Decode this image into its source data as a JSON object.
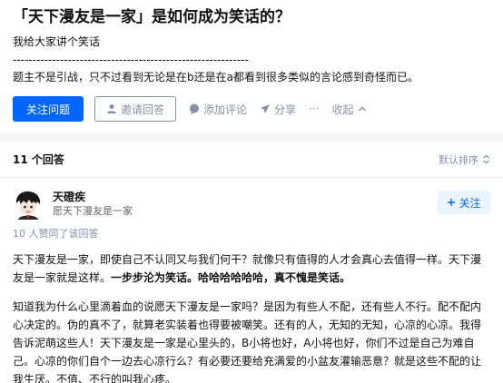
{
  "question": {
    "title": "「天下漫友是一家」是如何成为笑话的？",
    "detail": "我给大家讲个笑话",
    "dashes": "------------------------------------------------------------",
    "description": "题主不是引战，只不过看到无论是在b还是在a都看到很多类似的言论感到奇怪而已。"
  },
  "actions": {
    "follow_label": "关注问题",
    "invite_label": "邀请回答",
    "comment_label": "添加评论",
    "share_label": "分享",
    "more_label": "···",
    "collapse_label": "收起"
  },
  "answers_header": {
    "count_label": "11 个回答",
    "sort_label": "默认排序"
  },
  "answer": {
    "author_name": "天磴疾",
    "author_bio": "愿天下漫友是一家",
    "follow_label": "关注",
    "upvote_info": "10 人赞同了该回答",
    "p1_text": "天下漫友是一家，即使自己不认同又与我们何干？就像只有值得的人才会真心去值得一样。天下漫友是一家就是这样。",
    "p1_bold": "一步步沦为笑话。哈哈哈哈哈哈，真不愧是笑话。",
    "p2_text": "知道我为什么心里滴着血的说愿天下漫友是一家吗？是因为有些人不配，还有些人不行。配不配内心决定的。伪的真不了，就算老实装着也得要被嘲笑。还有的人，无知的无知，心凉的心凉。我得告诉泥萌这些人！天下漫友是一家是心里头的，B小将也好，A小将也好，你们不过是自己为难自己。心凉的你们自个一边去心凉行么？有必要还要给充满爱的小盆友灌输恶意？就是这些不配的让我生厌。不值、不行的叫我心疼。"
  },
  "colors": {
    "primary": "#0066ff",
    "muted": "#8590a6",
    "text": "#121212",
    "follow_bg": "#ebf5ff"
  }
}
